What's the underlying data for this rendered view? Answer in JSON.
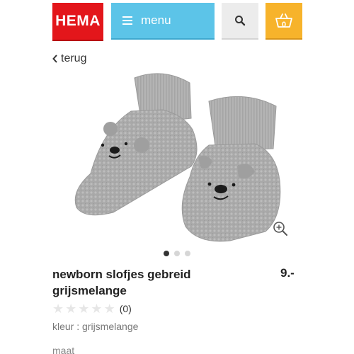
{
  "header": {
    "logo_text": "HEMA",
    "menu_label": "menu",
    "search_icon": "search-icon",
    "cart": {
      "count": "0",
      "icon": "basket-icon"
    },
    "colors": {
      "logo": "#e3161b",
      "menu": "#5cc4e8",
      "search": "#ececec",
      "cart": "#f7b32b"
    }
  },
  "nav": {
    "back_label": "terug",
    "back_icon": "chevron-left-icon"
  },
  "gallery": {
    "image_description_icon": "product-photo",
    "zoom_icon": "zoom-in-icon",
    "slide_count": 3,
    "active_slide": 1
  },
  "product": {
    "title": "newborn slofjes gebreid grijsmelange",
    "price": "9.-",
    "rating": {
      "stars": 0,
      "max": 5,
      "review_count": "(0)"
    },
    "color_info": "kleur : grijsmelange",
    "size_label": "maat"
  }
}
